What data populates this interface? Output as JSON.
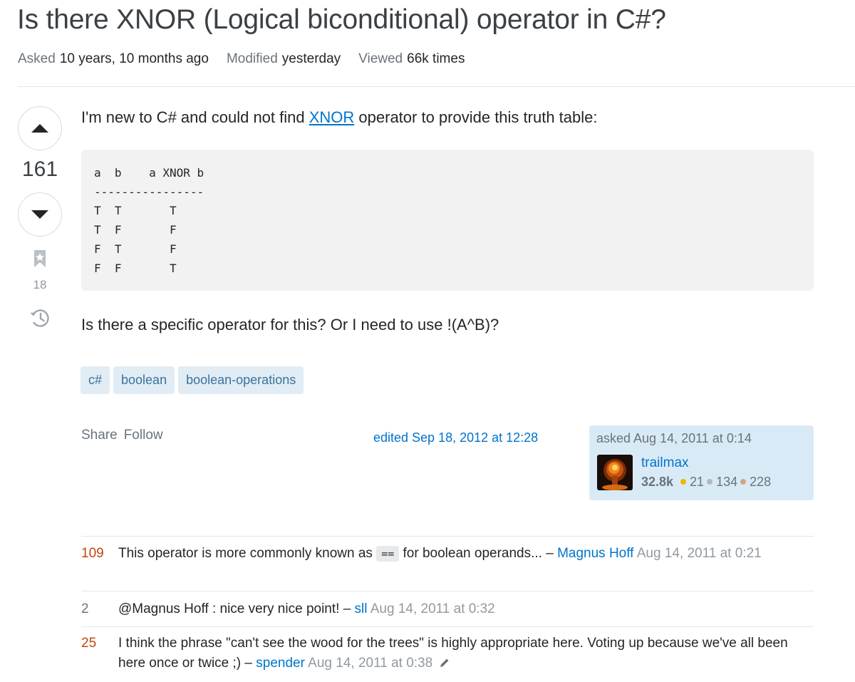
{
  "question": {
    "title": "Is there XNOR (Logical biconditional) operator in C#?",
    "meta": {
      "asked_label": "Asked",
      "asked_value": "10 years, 10 months ago",
      "modified_label": "Modified",
      "modified_value": "yesterday",
      "viewed_label": "Viewed",
      "viewed_value": "66k times"
    },
    "score": "161",
    "bookmarks": "18",
    "body": {
      "p1_before": "I'm new to C# and could not find ",
      "p1_link": "XNOR",
      "p1_after": " operator to provide this truth table:",
      "code": "a  b    a XNOR b\n----------------\nT  T       T\nT  F       F\nF  T       F\nF  F       T",
      "p2": "Is there a specific operator for this? Or I need to use !(A^B)?"
    },
    "tags": [
      "c#",
      "boolean",
      "boolean-operations"
    ],
    "actions": {
      "share": "Share",
      "follow": "Follow"
    },
    "edited": "edited Sep 18, 2012 at 12:28",
    "owner": {
      "asked": "asked Aug 14, 2011 at 0:14",
      "name": "trailmax",
      "reputation": "32.8k",
      "gold": "21",
      "silver": "134",
      "bronze": "228"
    }
  },
  "comments": [
    {
      "score": "109",
      "text_before": "This operator is more commonly known as ",
      "code": "==",
      "text_after": " for boolean operands... – ",
      "user": "Magnus Hoff",
      "date": "Aug 14, 2011 at 0:21"
    },
    {
      "score": "2",
      "text": "@Magnus Hoff : nice very nice point! – ",
      "user": "sll",
      "date": "Aug 14, 2011 at 0:32"
    },
    {
      "score": "25",
      "text": "I think the phrase \"can't see the wood for the trees\" is highly appropriate here. Voting up because we've all been here once or twice ;) – ",
      "user": "spender",
      "date": "Aug 14, 2011 at 0:38"
    }
  ],
  "icons": [
    "upvote-icon",
    "downvote-icon",
    "bookmark-icon",
    "history-icon",
    "edit-pencil-icon"
  ],
  "colors": {
    "link": "#0074cc",
    "tag_bg": "#e1ecf4",
    "tag_text": "#39739d",
    "owner_card": "#d9eaf7",
    "hot_score": "#c4450d"
  }
}
